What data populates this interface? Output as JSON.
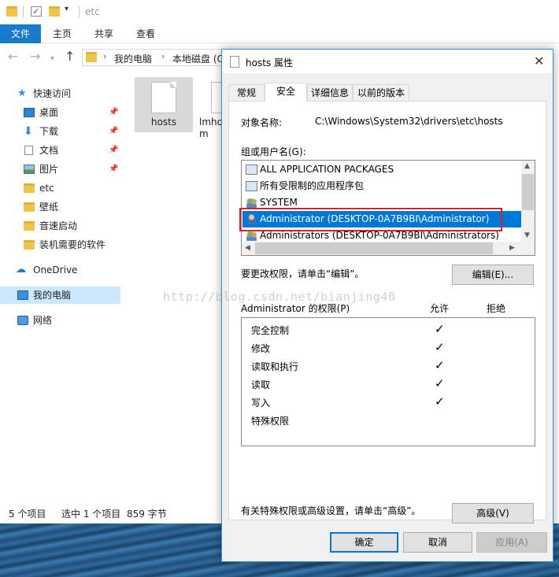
{
  "explorer": {
    "window_title": "etc",
    "ribbon_tabs": [
      "文件",
      "主页",
      "共享",
      "查看"
    ],
    "address_crumbs": [
      "我的电脑",
      "本地磁盘 (C"
    ],
    "sidebar": [
      {
        "label": "快速访问",
        "icon": "star-icon",
        "pinned": false
      },
      {
        "label": "桌面",
        "icon": "desktop-icon",
        "pinned": true
      },
      {
        "label": "下载",
        "icon": "download-icon",
        "pinned": true
      },
      {
        "label": "文档",
        "icon": "document-icon",
        "pinned": true
      },
      {
        "label": "图片",
        "icon": "pictures-icon",
        "pinned": true
      },
      {
        "label": "etc",
        "icon": "folder-icon",
        "pinned": false
      },
      {
        "label": "壁纸",
        "icon": "folder-icon",
        "pinned": false
      },
      {
        "label": "音速启动",
        "icon": "folder-icon",
        "pinned": false
      },
      {
        "label": "装机需要的软件",
        "icon": "folder-icon",
        "pinned": false
      },
      {
        "label": "OneDrive",
        "icon": "cloud-icon",
        "pinned": false
      },
      {
        "label": "我的电脑",
        "icon": "computer-icon",
        "pinned": false,
        "selected": true
      },
      {
        "label": "网络",
        "icon": "network-icon",
        "pinned": false
      }
    ],
    "files": [
      {
        "name": "hosts",
        "selected": true
      },
      {
        "name": "lmho\nm",
        "selected": false
      }
    ],
    "status": {
      "count": "5 个项目",
      "selection": "选中 1 个项目",
      "size": "859 字节"
    }
  },
  "watermark": "http://blog.csdn.net/bianjing40",
  "dialog": {
    "title": "hosts 属性",
    "tabs": [
      "常规",
      "安全",
      "详细信息",
      "以前的版本"
    ],
    "active_tab": "安全",
    "object_label": "对象名称:",
    "object_path": "C:\\Windows\\System32\\drivers\\etc\\hosts",
    "groups_label": "组或用户名(G):",
    "principals": [
      {
        "name": "ALL APPLICATION PACKAGES",
        "icon": "package-icon",
        "selected": false
      },
      {
        "name": "所有受限制的应用程序包",
        "icon": "package-icon",
        "selected": false
      },
      {
        "name": "SYSTEM",
        "icon": "group-icon",
        "selected": false
      },
      {
        "name": "Administrator (DESKTOP-0A7B9BI\\Administrator)",
        "icon": "user-icon",
        "selected": true
      },
      {
        "name": "Administrators (DESKTOP-0A7B9BI\\Administrators)",
        "icon": "group-icon",
        "selected": false
      }
    ],
    "change_hint": "要更改权限，请单击“编辑”。",
    "edit_button": "编辑(E)...",
    "permissions_label": "Administrator 的权限(P)",
    "allow_header": "允许",
    "deny_header": "拒绝",
    "permissions": [
      {
        "name": "完全控制",
        "allow": "✓",
        "deny": ""
      },
      {
        "name": "修改",
        "allow": "✓",
        "deny": ""
      },
      {
        "name": "读取和执行",
        "allow": "✓",
        "deny": ""
      },
      {
        "name": "读取",
        "allow": "✓",
        "deny": ""
      },
      {
        "name": "写入",
        "allow": "✓",
        "deny": ""
      },
      {
        "name": "特殊权限",
        "allow": "",
        "deny": ""
      }
    ],
    "advanced_hint": "有关特殊权限或高级设置，请单击“高级”。",
    "advanced_button": "高级(V)",
    "ok_button": "确定",
    "cancel_button": "取消",
    "apply_button": "应用(A)",
    "accent_color": "#0078d7",
    "highlight_color": "#e02020"
  }
}
